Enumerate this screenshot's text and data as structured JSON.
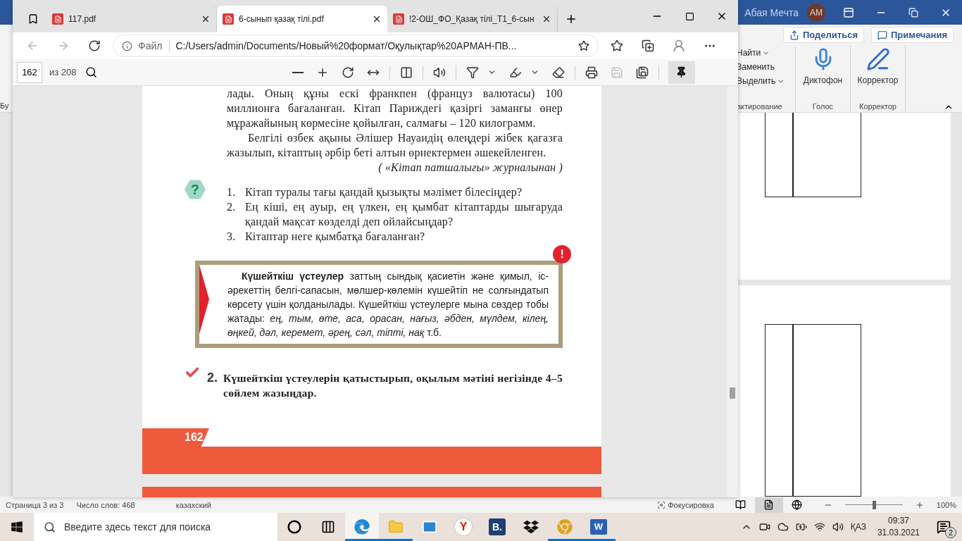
{
  "word": {
    "user_name": "Абая Мечта",
    "avatar_initials": "AM",
    "share_button": "Поделиться",
    "comments_button": "Примечания",
    "left_fragment": "Бу",
    "editing_items": [
      {
        "label": "Найти",
        "menu": true
      },
      {
        "label": "Заменить",
        "menu": false
      },
      {
        "label": "Выделить",
        "menu": true
      }
    ],
    "editing_group": "актирование",
    "voice_button": "Диктофон",
    "voice_group": "Голос",
    "editor_button": "Корректор",
    "editor_group": "Корректор",
    "status_bar": {
      "page": "Страница 3 из 3",
      "words": "Число слов: 468",
      "language": "казахский",
      "focus": "Фокусировка",
      "views": [
        {
          "kind": "read",
          "selected": false
        },
        {
          "kind": "print",
          "selected": true
        },
        {
          "kind": "web",
          "selected": false
        }
      ],
      "zoom": {
        "level": 0.5,
        "reading": "100%"
      }
    }
  },
  "browser": {
    "tabs": [
      {
        "title": "117.pdf",
        "selected": false
      },
      {
        "title": "6-сынып қазақ тілі.pdf",
        "selected": true
      },
      {
        "title": "!2-ОШ_ФО_Қазақ тілі_Т1_6-сын",
        "selected": false
      }
    ],
    "address": {
      "scheme": "Файл",
      "url": "C:/Users/admin/Documents/Новый%20формат/Оқулықтар%20АРМАН-ПВ..."
    },
    "pdf_toolbar": {
      "page": "162",
      "total": "из 208",
      "pinned": true,
      "tool_groups": [
        [
          {
            "kind": "zoom-out",
            "disabled": false,
            "menu": false
          },
          {
            "kind": "zoom-in",
            "disabled": false,
            "menu": false
          },
          {
            "kind": "rotate",
            "disabled": false,
            "menu": false
          },
          {
            "kind": "fit",
            "disabled": false,
            "menu": false
          }
        ],
        [
          {
            "kind": "page-view",
            "disabled": false,
            "menu": false
          }
        ],
        [
          {
            "kind": "read-aloud",
            "disabled": false,
            "menu": false
          }
        ],
        [
          {
            "kind": "draw",
            "disabled": false,
            "menu": true
          },
          {
            "kind": "highlight",
            "disabled": false,
            "menu": true
          },
          {
            "kind": "erase",
            "disabled": false,
            "menu": false
          }
        ],
        [
          {
            "kind": "print",
            "disabled": false,
            "menu": false
          },
          {
            "kind": "save",
            "disabled": true,
            "menu": false
          },
          {
            "kind": "save-as",
            "disabled": false,
            "menu": false
          }
        ]
      ]
    },
    "page": {
      "paragraphs": [
        "лады. Оның құны ескі франкпен (француз валютасы) 100 миллионға бағаланған. Кітап Париждегі қазіргі заманғы өнер мұражайының көрмесіне қойылған, салмағы – 120 килограмм.",
        "Белгілі өзбек ақыны Әлішер Науаидің өлеңдері жібек қағазға жазылып, кітаптың әрбір беті алтын өрнектермен әшекейленген."
      ],
      "source": "( «Кітап патшалығы» журналынан )",
      "question_mark": "?",
      "questions": [
        {
          "number": "1.",
          "text": "Кітап туралы тағы қандай қызықты мәлімет білесіңдер?"
        },
        {
          "number": "2.",
          "text": "Ең кіші, ең ауыр, ең үлкен, ең қымбат кітаптарды шығаруда қандай мақсат көзделді деп ойлайсыңдар?"
        },
        {
          "number": "3.",
          "text": "Кітаптар неге қымбатқа бағаланған?"
        }
      ],
      "rule_mark": "!",
      "rule": "**Күшейткіш үстеулер** заттың сындық қасиетін және қимыл, іс-әрекеттің белгі-сапасын, мөлшер-көлемін күшейтіп не солғындатып көрсету үшін қолданылады. Күшейткіш үстеулерге мына сөздер тобы жатады: *ең, тым, өте, аса, орасан, нағыз, әбден, мүлдем, кілең, өңкей, дәл, керемет, әрең, сәл, тіпті, нақ* т.б.",
      "task": {
        "number": "2.",
        "text": "Күшейткіш үстеулерін қатыстырып, оқылым мәтіні негізінде 4–5 сөйлем жазыңдар."
      },
      "page_number": "162"
    }
  },
  "taskbar": {
    "search_placeholder": "Введите здесь текст для поиска",
    "apps": [
      {
        "kind": "cortana",
        "running": false,
        "selected": false
      },
      {
        "kind": "task-view",
        "running": false,
        "selected": false
      },
      {
        "kind": "edge",
        "running": true,
        "selected": true
      },
      {
        "kind": "explorer",
        "running": true,
        "selected": false
      },
      {
        "kind": "mail",
        "running": false,
        "selected": false
      },
      {
        "kind": "yandex",
        "label": "Y",
        "running": false,
        "selected": false
      },
      {
        "kind": "booking",
        "label": "B.",
        "running": false,
        "selected": false
      },
      {
        "kind": "dropbox",
        "running": false,
        "selected": false
      },
      {
        "kind": "chrome",
        "running": true,
        "selected": false
      },
      {
        "kind": "word",
        "label": "W",
        "running": true,
        "selected": false
      }
    ],
    "language": "ҚАЗ",
    "time": "09:37",
    "date": "31.03.2021",
    "notifications": "2"
  }
}
